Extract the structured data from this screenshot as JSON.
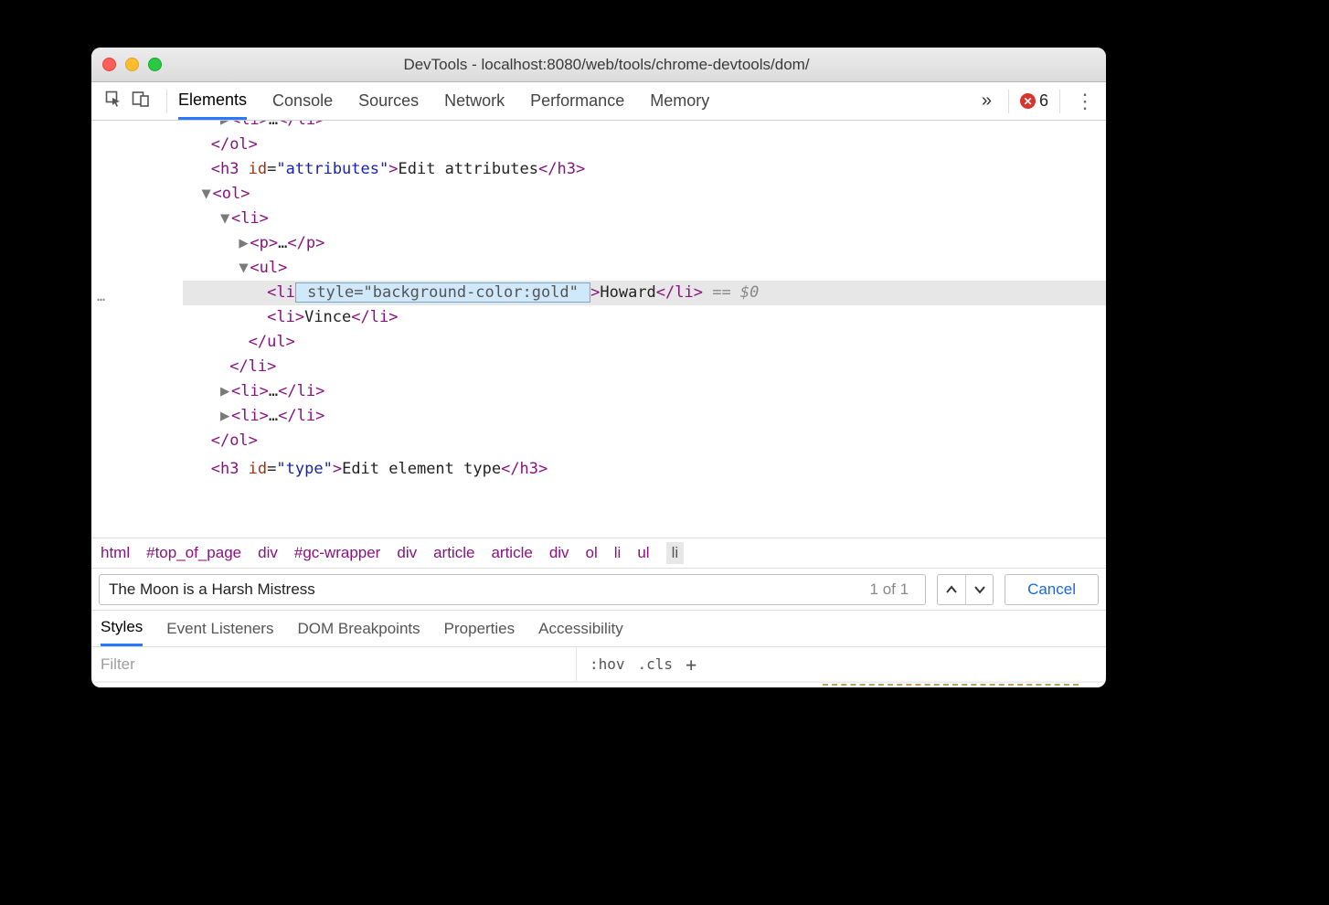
{
  "window": {
    "title": "DevTools - localhost:8080/web/tools/chrome-devtools/dom/"
  },
  "mainTabs": {
    "items": [
      "Elements",
      "Console",
      "Sources",
      "Network",
      "Performance",
      "Memory"
    ],
    "activeIndex": 0,
    "overflowGlyph": "»"
  },
  "errors": {
    "count": "6"
  },
  "dom": {
    "gutterEllipsis": "…",
    "lines": [
      {
        "indent": 2,
        "tri": "▶",
        "open": "<li>",
        "mid": "…",
        "close": "</li>",
        "cutTop": true
      },
      {
        "indent": 1,
        "close": "</ol>"
      },
      {
        "indent": 1,
        "open": "<h3 ",
        "attrs": [
          {
            "n": "id",
            "v": "attributes"
          }
        ],
        "afterOpen": ">",
        "text": "Edit attributes",
        "close": "</h3>"
      },
      {
        "indent": 1,
        "tri": "▼",
        "open": "<ol>"
      },
      {
        "indent": 2,
        "tri": "▼",
        "open": "<li>"
      },
      {
        "indent": 3,
        "tri": "▶",
        "open": "<p>",
        "mid": "…",
        "close": "</p>"
      },
      {
        "indent": 3,
        "tri": "▼",
        "open": "<ul>"
      },
      {
        "indent": 4,
        "hl": true,
        "open": "<li",
        "editAttr": " style=\"background-color:gold\" ",
        "afterOpen": ">",
        "text": "Howard",
        "close": "</li>",
        "suffix": " == $0"
      },
      {
        "indent": 4,
        "open": "<li>",
        "text": "Vince",
        "close": "</li>"
      },
      {
        "indent": 3,
        "close": "</ul>"
      },
      {
        "indent": 2,
        "close": "</li>"
      },
      {
        "indent": 2,
        "tri": "▶",
        "open": "<li>",
        "mid": "…",
        "close": "</li>"
      },
      {
        "indent": 2,
        "tri": "▶",
        "open": "<li>",
        "mid": "…",
        "close": "</li>"
      },
      {
        "indent": 1,
        "close": "</ol>"
      },
      {
        "indent": 1,
        "open": "<h3 ",
        "attrs": [
          {
            "n": "id",
            "v": "type"
          }
        ],
        "afterOpen": ">",
        "text": "Edit element type",
        "close": "</h3>",
        "cutBottom": true
      }
    ]
  },
  "breadcrumb": {
    "items": [
      "html",
      "#top_of_page",
      "div",
      "#gc-wrapper",
      "div",
      "article",
      "article",
      "div",
      "ol",
      "li",
      "ul",
      "li"
    ],
    "selectedIndex": 11
  },
  "search": {
    "value": "The Moon is a Harsh Mistress",
    "count": "1 of 1",
    "cancel": "Cancel"
  },
  "subTabs": {
    "items": [
      "Styles",
      "Event Listeners",
      "DOM Breakpoints",
      "Properties",
      "Accessibility"
    ],
    "activeIndex": 0
  },
  "stylesBar": {
    "filterPlaceholder": "Filter",
    "hov": ":hov",
    "cls": ".cls",
    "plus": "+"
  }
}
